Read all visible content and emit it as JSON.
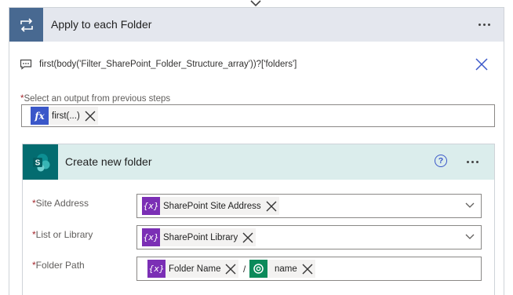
{
  "loop": {
    "title": "Apply to each Folder",
    "expression": "first(body('Filter_SharePoint_Folder_Structure_array'))?['folders']",
    "output_label": "Select an output from previous steps",
    "required_marker": "*",
    "output_token": {
      "label": "first(...)",
      "icon": "fx-icon",
      "icon_text": "fx"
    }
  },
  "action": {
    "title": "Create new folder",
    "help_text": "?",
    "fields": [
      {
        "label": "Site Address",
        "token": "SharePoint Site Address",
        "icon": "variable-icon",
        "icon_text": "{x}"
      },
      {
        "label": "List or Library",
        "token": "SharePoint Library",
        "icon": "variable-icon",
        "icon_text": "{x}"
      },
      {
        "label": "Folder Path",
        "token": "Folder Name",
        "icon": "variable-icon",
        "icon_text": "{x}",
        "separator": "/",
        "token2": "name",
        "icon2": "dataverse-icon"
      }
    ]
  },
  "colors": {
    "loop_header_bg": "#e4e7ee",
    "loop_icon_bg": "#486991",
    "action_header_bg": "#dbedec",
    "sharepoint_icon_bg": "#036c70",
    "fx_token": "#3a57c9",
    "variable_token": "#7b2fb5",
    "dataverse_token": "#0b8a5a",
    "required": "#a4262c"
  }
}
